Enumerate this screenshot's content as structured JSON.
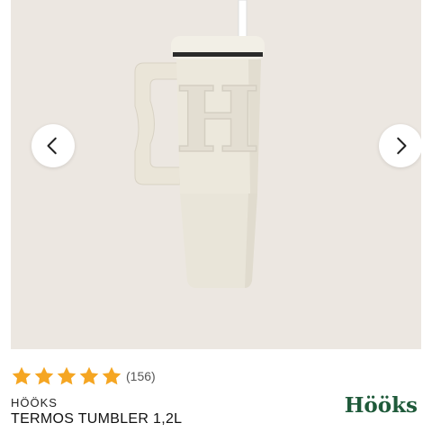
{
  "gallery": {
    "prev_icon": "chevron-left-icon",
    "next_icon": "chevron-right-icon",
    "image_monogram": "H",
    "background_color": "#ece7e1"
  },
  "product": {
    "rating": 5,
    "star_icon": "star-icon",
    "star_color": "#f5a623",
    "review_count": "(156)",
    "brand": "HÖÖKS",
    "name": "TERMOS TUMBLER 1,2L"
  },
  "logo": {
    "text": "Hööks",
    "color": "#1f5a3a"
  }
}
